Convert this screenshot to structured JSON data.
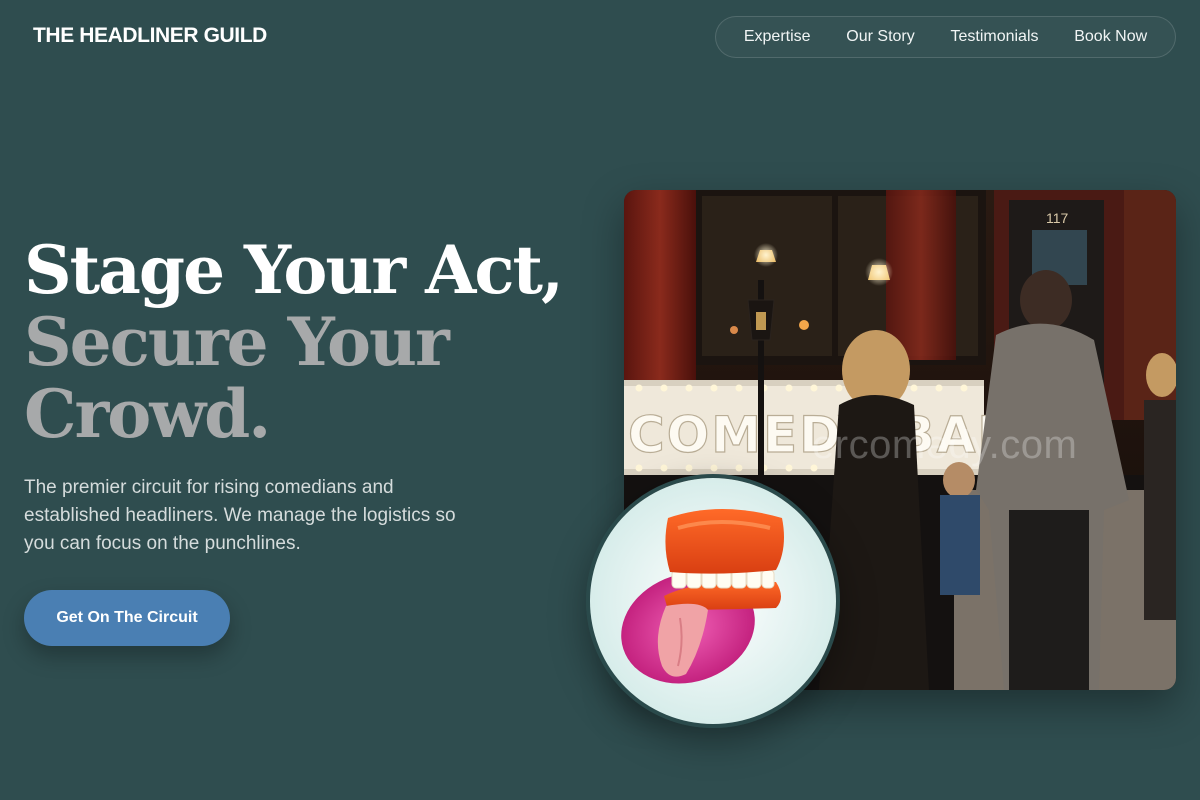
{
  "header": {
    "brand": "THE HEADLINER GUILD",
    "nav": [
      "Expertise",
      "Our Story",
      "Testimonials",
      "Book Now"
    ]
  },
  "hero": {
    "headline_line1": "Stage Your Act,",
    "headline_line2": "Secure Your",
    "headline_line3": "Crowd.",
    "subtitle": "The premier circuit for rising comedians and established headliners. We manage the logistics so you can focus on the punchlines.",
    "cta_label": "Get On The Circuit"
  },
  "media": {
    "photo_sign_text": "COMEDY BAR",
    "door_number": "117",
    "watermark": "ercomedy.com"
  },
  "colors": {
    "background": "#2f4d4f",
    "accent": "#4a7fb3",
    "headline_muted": "#a7a9aa"
  }
}
